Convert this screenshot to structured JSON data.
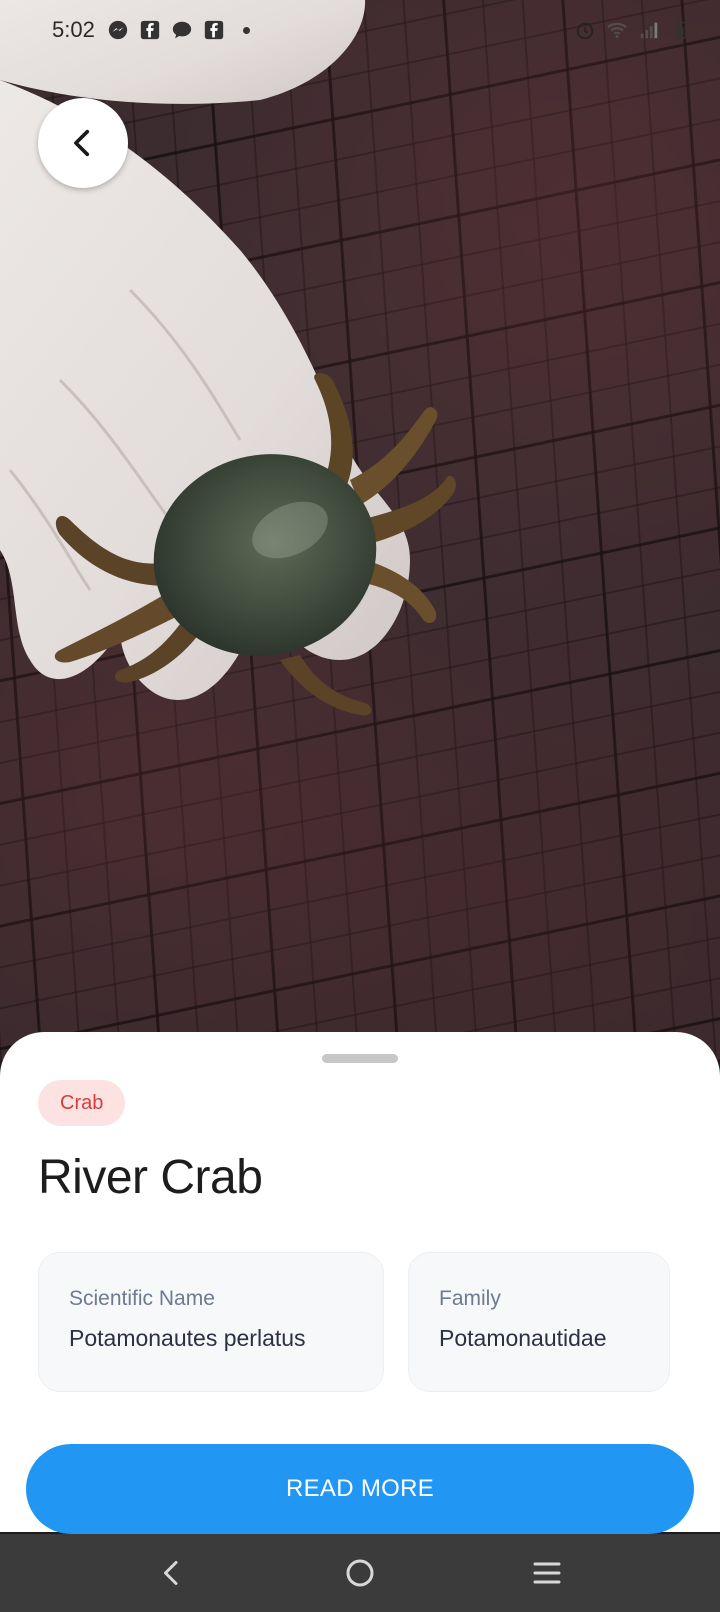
{
  "status_bar": {
    "time": "5:02",
    "left_icons": [
      "messenger-icon",
      "facebook-icon",
      "chat-bubble-icon",
      "facebook-icon"
    ],
    "right_icons": [
      "alarm-icon",
      "wifi-icon",
      "signal-icon",
      "battery-icon"
    ]
  },
  "photo": {
    "subject": "crab-photo"
  },
  "sheet": {
    "category": "Crab",
    "title": "River Crab",
    "cards": [
      {
        "label": "Scientific Name",
        "value": "Potamonautes perlatus"
      },
      {
        "label": "Family",
        "value": "Potamonautidae"
      }
    ],
    "read_more_label": "READ MORE"
  },
  "colors": {
    "accent": "#2196f3",
    "chip_bg": "#fde2e2",
    "chip_text": "#d33d3d",
    "card_label": "#6e7a90",
    "navbar": "#3b3b3b"
  },
  "navbar": {
    "icons": [
      "nav-back-icon",
      "nav-home-icon",
      "nav-menu-icon"
    ]
  }
}
